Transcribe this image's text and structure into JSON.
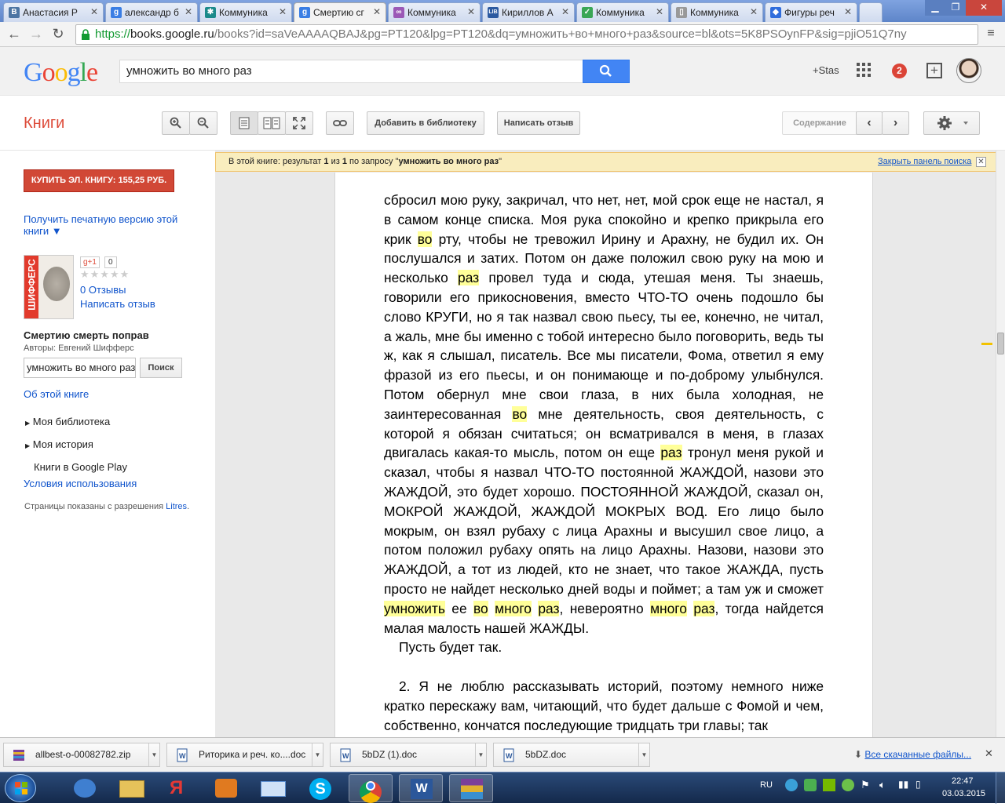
{
  "browser": {
    "tabs": [
      {
        "title": "Анастасия Р",
        "fav": "В",
        "favcolor": "#4c75a3"
      },
      {
        "title": "александр б",
        "fav": "g",
        "favcolor": "#3a7ee4"
      },
      {
        "title": "Коммуника",
        "fav": "✱",
        "favcolor": "#1b8a8a"
      },
      {
        "title": "Смертию сг",
        "fav": "g",
        "favcolor": "#3a7ee4",
        "active": true
      },
      {
        "title": "Коммуника",
        "fav": "∞",
        "favcolor": "#9b59b6"
      },
      {
        "title": "Кириллов А",
        "fav": "LIB",
        "favcolor": "#2c5aa0"
      },
      {
        "title": "Коммуника",
        "fav": "✓",
        "favcolor": "#3aa655"
      },
      {
        "title": "Коммуника",
        "fav": "▯",
        "favcolor": "#999999"
      },
      {
        "title": "Фигуры реч",
        "fav": "◆",
        "favcolor": "#2f6ddc"
      }
    ],
    "url": {
      "scheme": "https://",
      "host": "books.google.ru",
      "path": "/books?id=saVeAAAAQBAJ&pg=PT120&lpg=PT120&dq=умножить+во+много+раз&source=bl&ots=5K8PSOynFP&sig=pjiO51Q7ny"
    }
  },
  "google": {
    "logo": "Google",
    "search_query": "умножить во много раз",
    "user_label": "+Stas",
    "notifications": "2"
  },
  "books": {
    "title": "Книги",
    "add_library": "Добавить в библиотеку",
    "write_review": "Написать отзыв",
    "contents": "Содержание"
  },
  "notice": {
    "prefix": "В этой книге: результат ",
    "n1": "1",
    "mid": " из ",
    "n2": "1",
    "mid2": " по запросу \"",
    "query": "умножить во много раз",
    "suffix": "\"",
    "close_link": "Закрыть панель поиска"
  },
  "sidebar": {
    "buy_button": "КУПИТЬ ЭЛ. КНИГУ: 155,25 РУБ.",
    "print_version": "Получить печатную версию этой книги ▼",
    "cover_text": "ШИФФЕРС",
    "gplus": "g+1",
    "gplus_count": "0",
    "reviews": "0 Отзывы",
    "write_review": "Написать отзыв",
    "book_title": "Смертию смерть поправ",
    "authors": "Авторы: Евгений Шифферс",
    "search_value": "умножить во много раз",
    "search_button": "Поиск",
    "about": "Об этой книге",
    "my_library": "Моя библиотека",
    "my_history": "Моя история",
    "play_books": "Книги в Google Play",
    "terms": "Условия использования",
    "pages_shown_prefix": "Страницы показаны с разрешения ",
    "pages_shown_link": "Litres",
    "pages_shown_suffix": "."
  },
  "page_text": {
    "p1_a": "сбросил мою руку, закричал, что нет, нет, мой срок еще не настал, я в самом конце списка. Моя рука спокойно и крепко прикрыла его крик ",
    "p1_hl1": "во",
    "p1_b": " рту, чтобы не тревожил Ирину и Арахну, не будил их. Он послушался и затих. Потом он даже положил свою руку на мою и несколько ",
    "p1_hl2": "раз",
    "p1_c": " провел туда и сюда, утешая меня. Ты знаешь, говорили его прикосновения, вместо ЧТО-ТО очень подошло бы слово КРУГИ, но я так назвал свою пьесу, ты ее, конечно, не читал, а жаль, мне бы именно с тобой интересно было поговорить, ведь ты ж, как я слышал, писатель. Все мы писатели, Фома, ответил я ему фразой из его пьесы, и он понимающе и по-доброму улыбнулся. Потом обернул мне свои глаза, в них была холодная, не заинтересованная ",
    "p1_hl3": "во",
    "p1_d": " мне деятельность, своя деятельность, с которой я обязан считаться; он всматривался в меня, в глазах двигалась какая-то мысль, потом он еще ",
    "p1_hl4": "раз",
    "p1_e": " тронул меня рукой и сказал, чтобы я назвал ЧТО-ТО постоянной ЖАЖДОЙ, назови это ЖАЖДОЙ, это будет хорошо. ПОСТОЯННОЙ ЖАЖДОЙ, сказал он, МОКРОЙ ЖАЖДОЙ, ЖАЖДОЙ МОКРЫХ ВОД. Его лицо было мокрым, он взял рубаху с лица Арахны и высушил свое лицо, а потом положил рубаху опять на лицо Арахны. Назови, назови это ЖАЖДОЙ, а тот из людей, кто не знает, что такое ЖАЖДА, пусть просто не найдет несколько дней воды и поймет; а там уж и сможет ",
    "p1_hl5": "умножить",
    "p1_f": " ее ",
    "p1_hl6": "во",
    "p1_g": " ",
    "p1_hl7": "много",
    "p1_h": " ",
    "p1_hl8": "раз",
    "p1_i": ", невероятно ",
    "p1_hl9": "много",
    "p1_j": " ",
    "p1_hl10": "раз",
    "p1_k": ", тогда найдется малая малость нашей ЖАЖДЫ.",
    "p2": "Пусть будет так.",
    "p3": "2. Я не люблю рассказывать историй, поэтому немного ниже кратко перескажу вам, читающий, что будет дальше с Фомой и чем, собственно, кончатся последующие тридцать три главы; так"
  },
  "downloads": {
    "items": [
      "allbest-o-00082782.zip",
      "Риторика  и реч. ко....doc",
      "5bDZ (1).doc",
      "5bDZ.doc"
    ],
    "all_link": "Все скачанные файлы..."
  },
  "taskbar": {
    "lang": "RU",
    "time": "22:47",
    "date": "03.03.2015"
  },
  "colors": {
    "accent_red": "#dd4b39",
    "link_blue": "#1155cc",
    "highlight": "#ffff99",
    "search_blue": "#4285f4"
  }
}
